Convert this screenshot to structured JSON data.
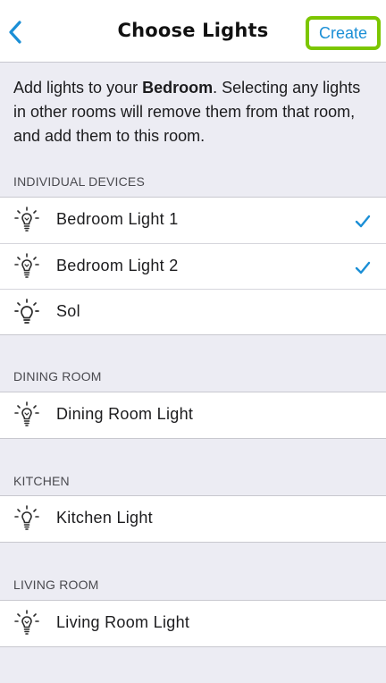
{
  "nav": {
    "title": "Choose Lights",
    "create_label": "Create",
    "back_icon": "chevron-left-icon"
  },
  "intro": {
    "prefix": "Add lights to your ",
    "room": "Bedroom",
    "suffix": ". Selecting any lights in other rooms will remove them from that room, and add them to this room."
  },
  "sections": [
    {
      "header": "INDIVIDUAL DEVICES",
      "items": [
        {
          "label": "Bedroom Light 1",
          "icon": "bulb-on-icon",
          "checked": true
        },
        {
          "label": "Bedroom Light 2",
          "icon": "bulb-on-icon",
          "checked": true
        },
        {
          "label": "Sol",
          "icon": "round-bulb-icon",
          "checked": false
        }
      ]
    },
    {
      "header": "DINING ROOM",
      "items": [
        {
          "label": "Dining Room Light",
          "icon": "bulb-on-icon",
          "checked": false
        }
      ]
    },
    {
      "header": "KITCHEN",
      "items": [
        {
          "label": "Kitchen Light",
          "icon": "bulb-icon",
          "checked": false
        }
      ]
    },
    {
      "header": "LIVING ROOM",
      "items": [
        {
          "label": "Living Room Light",
          "icon": "bulb-on-icon",
          "checked": false
        }
      ]
    }
  ],
  "colors": {
    "accent": "#1b8fd6",
    "highlight": "#7cc600",
    "background": "#ececf3"
  }
}
